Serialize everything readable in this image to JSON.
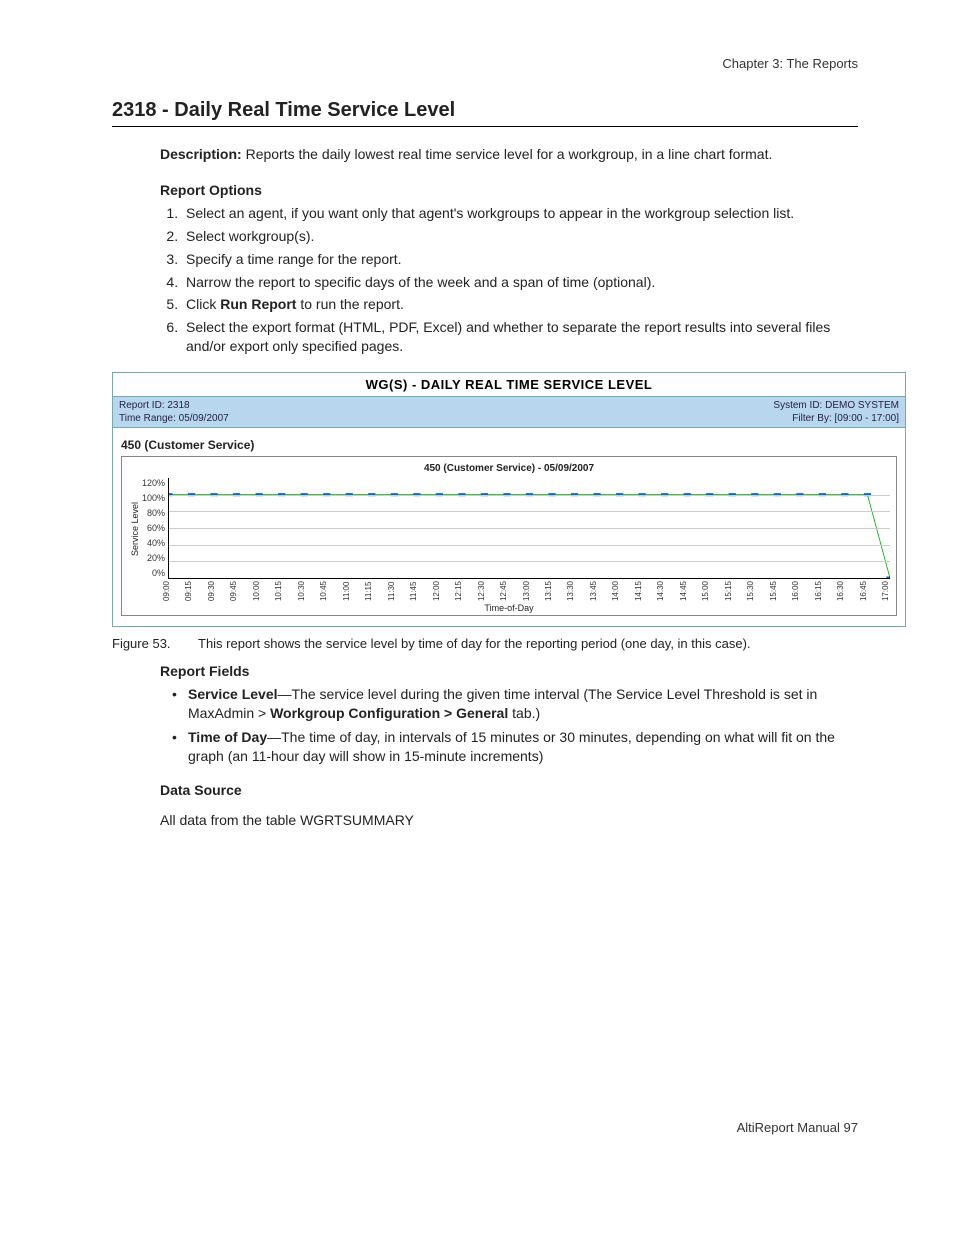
{
  "header": {
    "chapter": "Chapter 3:  The Reports"
  },
  "title": "2318 - Daily Real Time Service Level",
  "description_label": "Description:",
  "description": " Reports the daily lowest real time service level for a workgroup, in a line chart format.",
  "sections": {
    "options_heading": "Report Options",
    "options": [
      "Select an agent, if you want only that agent's workgroups to appear in the workgroup selection list.",
      "Select workgroup(s).",
      "Specify a time range for the report.",
      "Narrow the report to specific days of the week and a span of time (optional).",
      {
        "pre": "Click ",
        "bold": "Run Report",
        "post": " to run the report."
      },
      "Select the export format (HTML, PDF, Excel) and whether to separate the report results into several files and/or export only specified pages."
    ],
    "fields_heading": "Report Fields",
    "fields": [
      {
        "term": "Service Level",
        "text": "—The service level during the given time interval (The Service Level Threshold is set in MaxAdmin > ",
        "bold2": "Workgroup Configuration > General",
        "post2": " tab.)"
      },
      {
        "term": "Time of Day",
        "text": "—The time of day, in intervals of 15 minutes or 30 minutes, depending on what will fit on the graph (an 11-hour day will show in 15-minute increments)"
      }
    ],
    "datasource_heading": "Data Source",
    "datasource_text": "All data from the table WGRTSUMMARY"
  },
  "report_image": {
    "title": "WG(S) - DAILY REAL TIME SERVICE LEVEL",
    "meta_left": {
      "l1": "Report ID: 2318",
      "l2": "Time Range: 05/09/2007"
    },
    "meta_right": {
      "l1": "System ID: DEMO SYSTEM",
      "l2": "Filter By: [09:00 - 17:00]"
    },
    "workgroup": "450 (Customer Service)"
  },
  "figure": {
    "num": "Figure 53.",
    "caption": "This report shows the service level by time of day for the reporting period (one day, in this case)."
  },
  "footer": {
    "manual": "AltiReport Manual ",
    "page": "97"
  },
  "chart_data": {
    "type": "line",
    "title": "450 (Customer Service) - 05/09/2007",
    "xlabel": "Time-of-Day",
    "ylabel": "Service Level",
    "ylim": [
      0,
      120
    ],
    "y_ticks": [
      "120%",
      "100%",
      "80%",
      "60%",
      "40%",
      "20%",
      "0%"
    ],
    "categories": [
      "09:00",
      "09:15",
      "09:30",
      "09:45",
      "10:00",
      "10:15",
      "10:30",
      "10:45",
      "11:00",
      "11:15",
      "11:30",
      "11:45",
      "12:00",
      "12:15",
      "12:30",
      "12:45",
      "13:00",
      "13:15",
      "13:30",
      "13:45",
      "14:00",
      "14:15",
      "14:30",
      "14:45",
      "15:00",
      "15:15",
      "15:30",
      "15:45",
      "16:00",
      "16:15",
      "16:30",
      "16:45",
      "17:00"
    ],
    "values": [
      100,
      100,
      100,
      100,
      100,
      100,
      100,
      100,
      100,
      100,
      100,
      100,
      100,
      100,
      100,
      100,
      100,
      100,
      100,
      100,
      100,
      100,
      100,
      100,
      100,
      100,
      100,
      100,
      100,
      100,
      100,
      100,
      0
    ]
  }
}
